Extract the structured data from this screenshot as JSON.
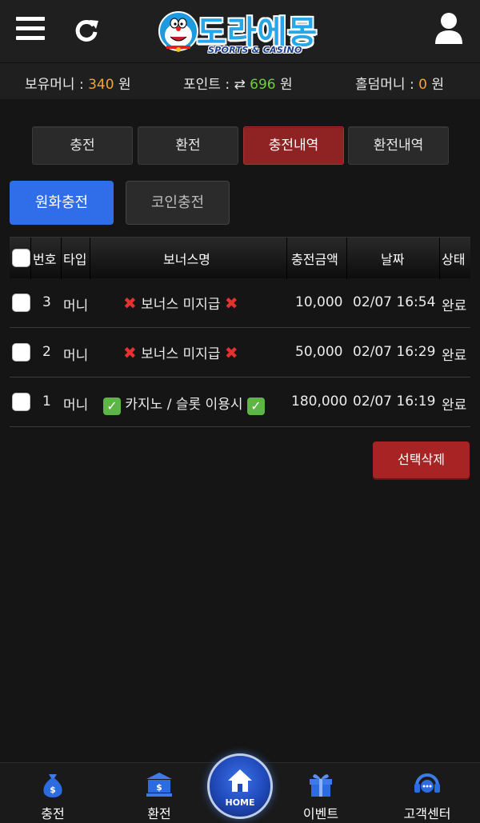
{
  "header": {
    "logo_text": "도라에몽",
    "logo_sub": "SPORTS & CASINO"
  },
  "balances": {
    "money_label": "보유머니 : ",
    "money_value": "340",
    "money_unit": " 원",
    "point_label": "포인트 : ",
    "point_icon": "⇄",
    "point_value": "696",
    "point_unit": " 원",
    "holdem_label": "홀덤머니 : ",
    "holdem_value": "0",
    "holdem_unit": " 원"
  },
  "tabs": [
    {
      "label": "충전"
    },
    {
      "label": "환전"
    },
    {
      "label": "충전내역",
      "active": true
    },
    {
      "label": "환전내역"
    }
  ],
  "subtabs": [
    {
      "label": "원화충전",
      "active": true
    },
    {
      "label": "코인충전"
    }
  ],
  "table": {
    "headers": {
      "no": "번호",
      "type": "타입",
      "bonus": "보너스명",
      "amount": "충전금액",
      "date": "날짜",
      "status": "상태"
    },
    "rows": [
      {
        "no": "3",
        "type": "머니",
        "bonus": "보너스 미지급",
        "bonus_mark": "x",
        "amount": "10,000",
        "date": "02/07 16:54",
        "status": "완료"
      },
      {
        "no": "2",
        "type": "머니",
        "bonus": "보너스 미지급",
        "bonus_mark": "x",
        "amount": "50,000",
        "date": "02/07 16:29",
        "status": "완료"
      },
      {
        "no": "1",
        "type": "머니",
        "bonus": "카지노 / 슬롯 이용시",
        "bonus_mark": "check",
        "amount": "180,000",
        "date": "02/07 16:19",
        "status": "완료"
      }
    ]
  },
  "actions": {
    "delete_selected": "선택삭제"
  },
  "bottom_nav": {
    "deposit": "충전",
    "withdraw": "환전",
    "home": "HOME",
    "event": "이벤트",
    "support": "고객센터"
  },
  "colors": {
    "accent_red": "#a82424",
    "accent_blue": "#2f6ee8",
    "money_orange": "#f2a532",
    "point_green": "#6fcf3a"
  }
}
